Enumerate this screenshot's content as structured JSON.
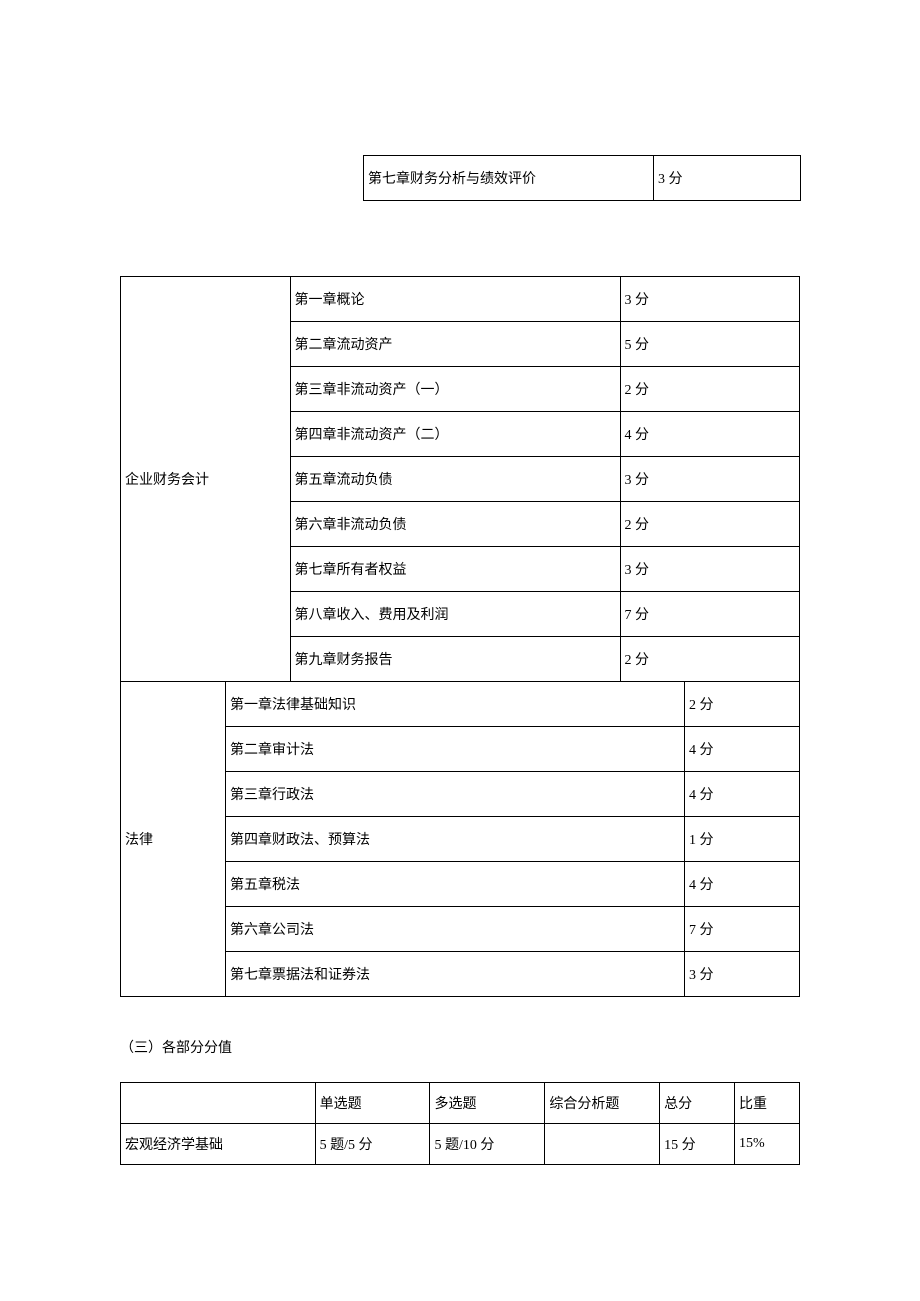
{
  "topTable": {
    "chapter": "第七章财务分析与绩效评价",
    "score": "3 分"
  },
  "subjects": {
    "accounting": {
      "name": "企业财务会计",
      "chapters": [
        {
          "title": "第一章概论",
          "score": "3 分"
        },
        {
          "title": "第二章流动资产",
          "score": "5 分"
        },
        {
          "title": "第三章非流动资产（一）",
          "score": "2 分"
        },
        {
          "title": "第四章非流动资产（二）",
          "score": "4 分"
        },
        {
          "title": "第五章流动负债",
          "score": "3 分"
        },
        {
          "title": "第六章非流动负债",
          "score": "2 分"
        },
        {
          "title": "第七章所有者权益",
          "score": "3 分"
        },
        {
          "title": "第八章收入、费用及利润",
          "score": "7 分"
        },
        {
          "title": "第九章财务报告",
          "score": "2 分"
        }
      ]
    },
    "law": {
      "name": "法律",
      "chapters": [
        {
          "title": "第一章法律基础知识",
          "score": "2 分"
        },
        {
          "title": "第二章审计法",
          "score": "4 分"
        },
        {
          "title": "第三章行政法",
          "score": "4 分"
        },
        {
          "title": "第四章财政法、预算法",
          "score": "1 分"
        },
        {
          "title": "第五章税法",
          "score": "4 分"
        },
        {
          "title": "第六章公司法",
          "score": "7 分"
        },
        {
          "title": "第七章票据法和证券法",
          "score": "3 分"
        }
      ]
    }
  },
  "sectionTitle": "（三）各部分分值",
  "scoreTable": {
    "headers": {
      "col1": "",
      "col2": "单选题",
      "col3": "多选题",
      "col4": "综合分析题",
      "col5": "总分",
      "col6": "比重"
    },
    "row1": {
      "subject": "宏观经济学基础",
      "single": "5 题/5 分",
      "multi": "5 题/10 分",
      "analysis": "",
      "total": "15 分",
      "weight": "15%"
    }
  }
}
